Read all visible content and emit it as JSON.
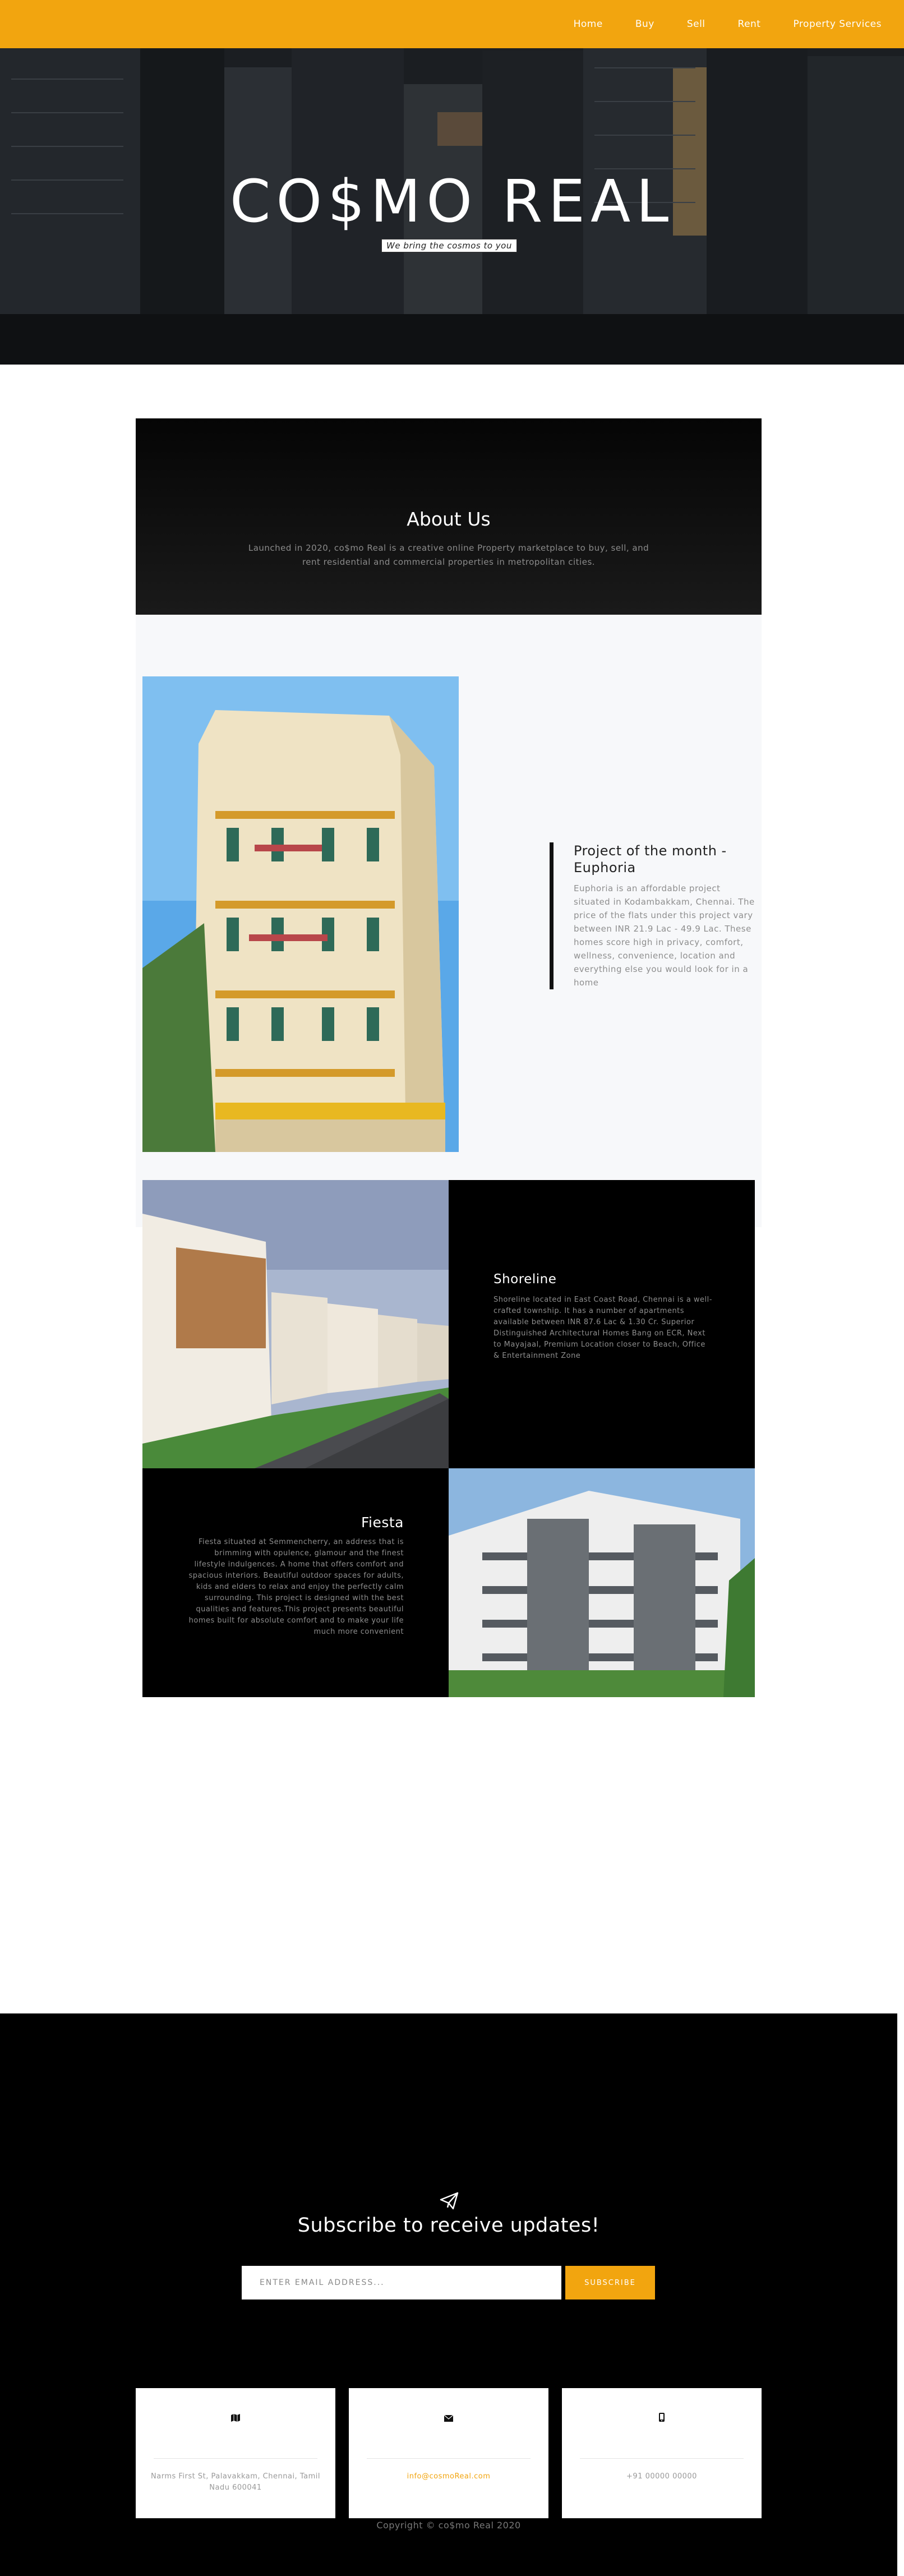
{
  "nav": {
    "items": [
      "Home",
      "Buy",
      "Sell",
      "Rent",
      "Property Services"
    ]
  },
  "hero": {
    "title": "CO$MO REAL",
    "tagline": "We bring the cosmos to you"
  },
  "about": {
    "title": "About Us",
    "text": "Launched in 2020, co$mo Real is a creative online Property marketplace to buy, sell, and rent residential and commercial properties in metropolitan cities."
  },
  "project_of_month": {
    "title": "Project of the month - Euphoria",
    "text": "Euphoria is an affordable project situated in Kodambakkam, Chennai. The price of the flats under this project vary between INR 21.9 Lac - 49.9 Lac. These homes score high in privacy, comfort, wellness, convenience, location and everything else you would look for in a home"
  },
  "shoreline": {
    "title": "Shoreline",
    "text": "Shoreline located in East Coast Road, Chennai is a well-crafted township. It has a number of apartments available between INR 87.6 Lac & 1.30 Cr. Superior Distinguished Architectural Homes Bang on ECR, Next to Mayajaal, Premium Location closer to Beach, Office & Entertainment Zone"
  },
  "fiesta": {
    "title": "Fiesta",
    "text": "Fiesta situated at Semmencherry, an address that is brimming with opulence, glamour and the finest lifestyle indulgences. A home that offers comfort and spacious interiors. Beautiful outdoor spaces for adults, kids and elders to relax and enjoy the perfectly calm surrounding. This project is designed with the best qualities and features.This project presents beautiful homes built for absolute comfort and to make your life much more convenient"
  },
  "subscribe": {
    "title": "Subscribe to receive updates!",
    "placeholder": "ENTER EMAIL ADDRESS...",
    "button": "SUBSCRIBE"
  },
  "contact": {
    "address": "Narms First St, Palavakkam, Chennai, Tamil Nadu 600041",
    "email": "info@cosmoReal.com",
    "phone": "+91 00000 00000"
  },
  "footer": {
    "copyright": "Copyright © co$mo Real 2020"
  },
  "colors": {
    "accent": "#f2a50f",
    "dark": "#000000"
  }
}
